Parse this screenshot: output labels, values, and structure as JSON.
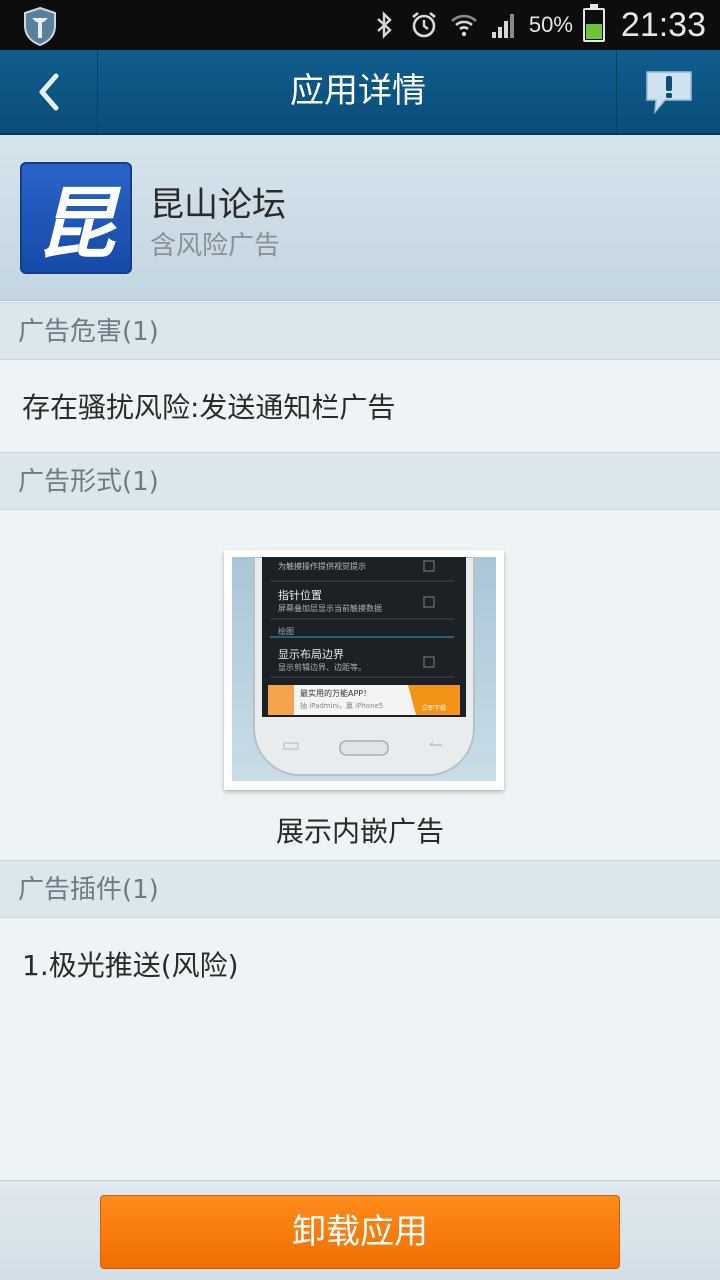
{
  "status_bar": {
    "battery_percent": "50%",
    "battery_level": 0.5,
    "time": "21:33"
  },
  "titlebar": {
    "title": "应用详情"
  },
  "app": {
    "icon_glyph": "昆",
    "name": "昆山论坛",
    "subtitle": "含风险广告"
  },
  "sections": {
    "ad_harm": {
      "header": "广告危害(1)",
      "item": "存在骚扰风险:发送通知栏广告"
    },
    "ad_form": {
      "header": "广告形式(1)",
      "caption": "展示内嵌广告",
      "preview": {
        "rows": [
          {
            "title": "指针位置",
            "desc": "屏幕叠加层显示当前触摸数据"
          },
          {
            "title": "显示布局边界",
            "desc": "显示剪辑边界、边距等。"
          }
        ],
        "group_label": "绘图",
        "top_desc": "为触摸操作提供视觉提示",
        "banner_title": "最实用的万能APP！",
        "banner_sub": "抽 iPadmini，赢 iPhone5",
        "banner_btn": "立即下载"
      }
    },
    "ad_plugin": {
      "header": "广告插件(1)",
      "item": "1.极光推送(风险)"
    }
  },
  "bottom": {
    "uninstall_label": "卸载应用"
  }
}
